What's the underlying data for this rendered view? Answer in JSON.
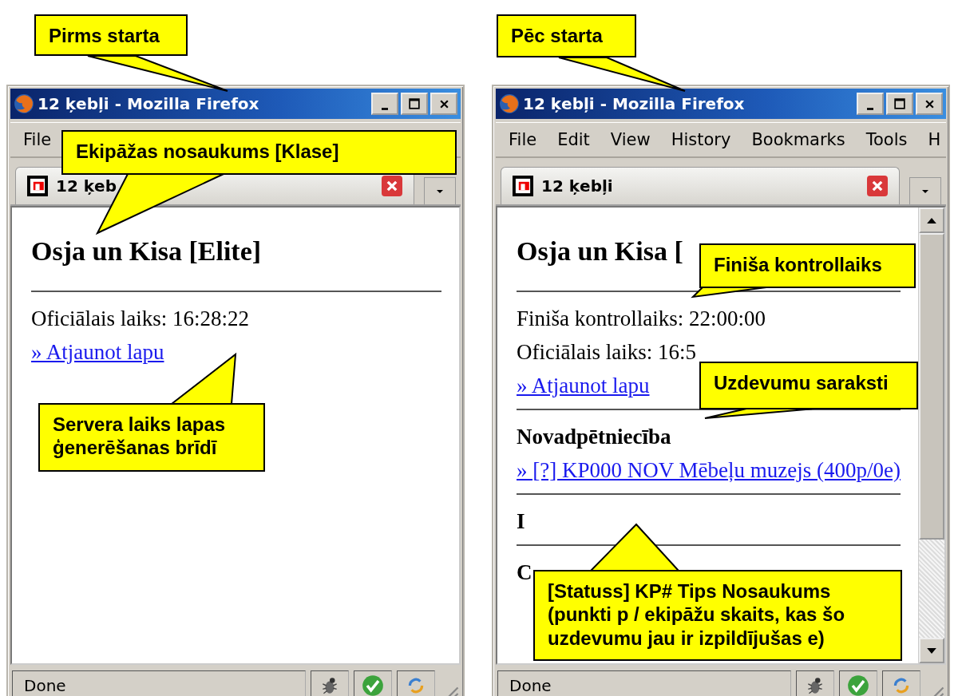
{
  "windows": [
    {
      "title": "12 ķebļi - Mozilla Firefox",
      "menu": [
        "File"
      ],
      "tab": {
        "label": "12 ķeb",
        "selected": true
      },
      "scrollbar": false,
      "content": [
        {
          "kind": "heading",
          "text": "Osja un Kisa [Elite]"
        },
        {
          "kind": "rule"
        },
        {
          "kind": "text",
          "text": "Oficiālais laiks: 16:28:22"
        },
        {
          "kind": "link",
          "text": "» Atjaunot lapu"
        }
      ],
      "status": "Done"
    },
    {
      "title": "12 ķebļi - Mozilla Firefox",
      "menu": [
        "File",
        "Edit",
        "View",
        "History",
        "Bookmarks",
        "Tools",
        "H"
      ],
      "tab": {
        "label": "12 ķebļi",
        "selected": true
      },
      "scrollbar": true,
      "content": [
        {
          "kind": "heading",
          "text": "Osja un Kisa ["
        },
        {
          "kind": "rule"
        },
        {
          "kind": "text",
          "text": "Finiša kontrollaiks: 22:00:00"
        },
        {
          "kind": "text",
          "text": "Oficiālais laiks: 16:5"
        },
        {
          "kind": "link",
          "text": "» Atjaunot lapu"
        },
        {
          "kind": "rule"
        },
        {
          "kind": "subheading",
          "text": "Novadpētniecība"
        },
        {
          "kind": "link",
          "text": "» [?] KP000 NOV Mēbeļu muzejs (400p/0e)"
        },
        {
          "kind": "rule"
        },
        {
          "kind": "subheading",
          "text": "I"
        },
        {
          "kind": "rule"
        },
        {
          "kind": "subheading",
          "text": "C"
        }
      ],
      "status": "Done"
    }
  ],
  "callouts": [
    {
      "text": "Pirms starta"
    },
    {
      "text": "Ekipāžas nosaukums [Klase]"
    },
    {
      "text": "Servera laiks lapas ģenerēšanas brīdī"
    },
    {
      "text": "Pēc starta"
    },
    {
      "text": "Finiša kontrollaiks"
    },
    {
      "text": "Uzdevumu saraksti"
    },
    {
      "text": "[Statuss] KP# Tips Nosaukums (punkti p / ekipāžu skaits, kas šo uzdevumu jau ir izpildījušas e)"
    }
  ]
}
